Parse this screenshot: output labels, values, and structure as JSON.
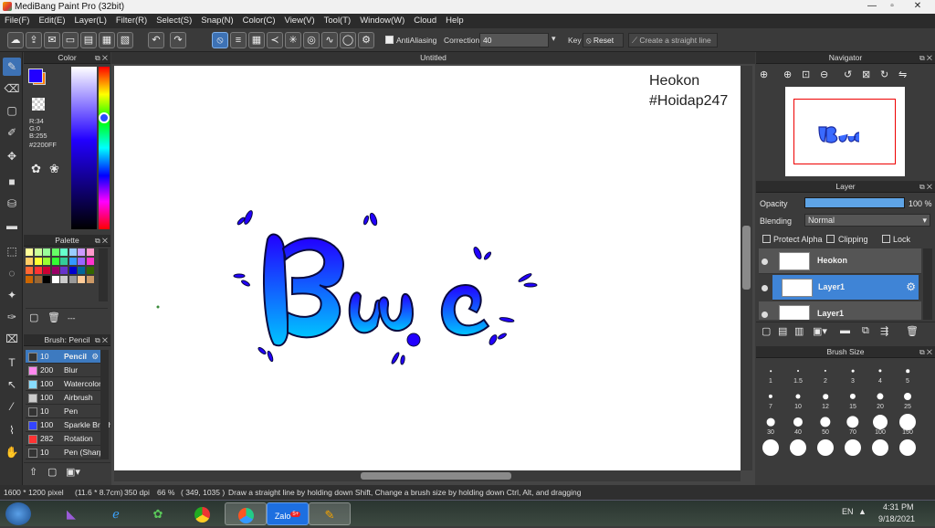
{
  "window": {
    "title": "MediBang Paint Pro (32bit)",
    "controls": [
      "—",
      "▫",
      "✕"
    ]
  },
  "menu": [
    "File(F)",
    "Edit(E)",
    "Layer(L)",
    "Filter(R)",
    "Select(S)",
    "Snap(N)",
    "Color(C)",
    "View(V)",
    "Tool(T)",
    "Window(W)",
    "Cloud",
    "Help"
  ],
  "toolbar": {
    "antialiasing_label": "AntiAliasing",
    "correction_label": "Correction",
    "correction_value": "40",
    "key_label": "Key",
    "reset_label": "Reset",
    "straight_line_label": "Create a straight line"
  },
  "color_panel": {
    "title": "Color",
    "r": "R:34",
    "g": "G:0",
    "b": "B:255",
    "hex": "#2200FF",
    "main_color": "#2200FF",
    "sub_color": "#FF7A00"
  },
  "palette_panel": {
    "title": "Palette",
    "footer_text": "---",
    "swatches": [
      "#ffff99",
      "#ccff99",
      "#99ff99",
      "#66ff66",
      "#66ffcc",
      "#99ccff",
      "#cc99ff",
      "#ff99cc",
      "#ffcc66",
      "#ffff33",
      "#99ff33",
      "#33ff33",
      "#33cc99",
      "#3399ff",
      "#9966ff",
      "#ff33cc",
      "#ff6633",
      "#ff3333",
      "#cc0033",
      "#990066",
      "#6633cc",
      "#0000cc",
      "#006699",
      "#336600",
      "#cc6600",
      "#996633",
      "#000000",
      "#ffffff",
      "#cccccc",
      "#999999",
      "#ffcc99",
      "#cc9966"
    ]
  },
  "brush_panel": {
    "title": "Brush: Pencil",
    "items": [
      {
        "size": "10",
        "name": "Pencil",
        "color": "#333333"
      },
      {
        "size": "200",
        "name": "Blur",
        "color": "#ff88ee"
      },
      {
        "size": "100",
        "name": "Watercolor",
        "color": "#88ddff"
      },
      {
        "size": "100",
        "name": "Airbrush",
        "color": "#cccccc"
      },
      {
        "size": "10",
        "name": "Pen",
        "color": "#333333"
      },
      {
        "size": "100",
        "name": "Sparkle Brush",
        "color": "#3344ff"
      },
      {
        "size": "282",
        "name": "Rotation",
        "color": "#ff3333"
      },
      {
        "size": "10",
        "name": "Pen (Sharp)",
        "color": "#333333"
      }
    ]
  },
  "document": {
    "tab_title": "Untitled",
    "watermark_line1": "Heokon",
    "watermark_line2": "#Hoidap247"
  },
  "navigator": {
    "title": "Navigator"
  },
  "layer_panel": {
    "title": "Layer",
    "opacity_label": "Opacity",
    "opacity_value": "100 %",
    "opacity_level": 1.0,
    "blending_label": "Blending",
    "blending_value": "Normal",
    "protect_alpha_label": "Protect Alpha",
    "clipping_label": "Clipping",
    "lock_label": "Lock",
    "layers": [
      {
        "name": "Heokon"
      },
      {
        "name": "Layer1"
      },
      {
        "name": "Layer1"
      }
    ]
  },
  "brush_size_panel": {
    "title": "Brush Size",
    "sizes": [
      "1",
      "1.5",
      "2",
      "3",
      "4",
      "5",
      "7",
      "10",
      "12",
      "15",
      "20",
      "25",
      "30",
      "40",
      "50",
      "70",
      "100",
      "150"
    ]
  },
  "status": {
    "dimensions": "1600 * 1200 pixel",
    "physical": "(11.6 * 8.7cm)",
    "dpi": "350 dpi",
    "zoom": "66 %",
    "cursor": "( 349, 1035 )",
    "hint": "Draw a straight line by holding down Shift, Change a brush size by holding down Ctrl, Alt, and dragging"
  },
  "taskbar": {
    "language": "EN",
    "time": "4:31 PM",
    "date": "9/18/2021",
    "zalo_badge": "5+"
  }
}
